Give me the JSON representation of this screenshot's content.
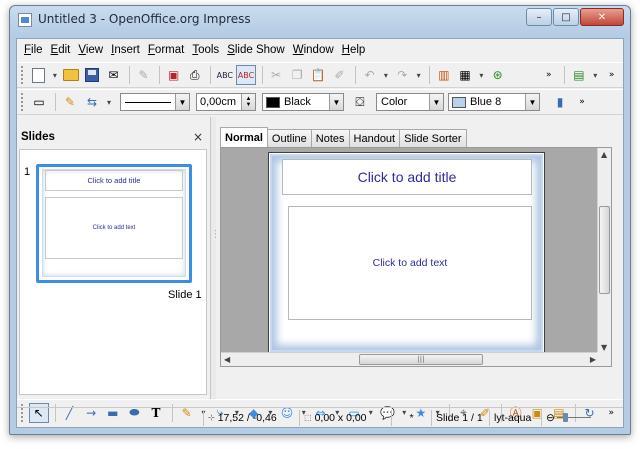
{
  "window": {
    "title": "Untitled 3 - OpenOffice.org Impress",
    "minimize": "–",
    "maximize": "□",
    "close": "✕"
  },
  "menu": [
    {
      "label": "File",
      "key": "F",
      "rest": "ile"
    },
    {
      "label": "Edit",
      "key": "E",
      "rest": "dit"
    },
    {
      "label": "View",
      "key": "V",
      "rest": "iew"
    },
    {
      "label": "Insert",
      "key": "I",
      "rest": "nsert"
    },
    {
      "label": "Format",
      "key": "F",
      "rest": "ormat"
    },
    {
      "label": "Tools",
      "key": "T",
      "rest": "ools"
    },
    {
      "label": "Slide Show",
      "key": "S",
      "rest": "lide Show"
    },
    {
      "label": "Window",
      "key": "W",
      "rest": "indow"
    },
    {
      "label": "Help",
      "key": "H",
      "rest": "elp"
    }
  ],
  "line_toolbar": {
    "line_width": "0,00cm",
    "line_color": "Black",
    "line_color_hex": "#000000",
    "area_style": "Color",
    "fill_color": "Blue 8",
    "fill_color_hex": "#b8d0ec"
  },
  "slides_panel": {
    "title": "Slides",
    "close": "×",
    "slide_number": "1",
    "thumb_title": "Click to add title",
    "thumb_text": "Click to add text",
    "caption": "Slide 1"
  },
  "view_tabs": [
    "Normal",
    "Outline",
    "Notes",
    "Handout",
    "Slide Sorter"
  ],
  "active_tab": "Normal",
  "slide": {
    "title_placeholder": "Click to add title",
    "text_placeholder": "Click to add text"
  },
  "statusbar": {
    "position": "17,52 / -0,46",
    "size": "0,00 x 0,00",
    "modified": "*",
    "page": "Slide 1 / 1",
    "layout": "lyt-aqua",
    "zoom_minus": "⊖"
  },
  "colors": {
    "accent": "#3a8ee6",
    "placeholder_text": "#2f2aa0"
  }
}
